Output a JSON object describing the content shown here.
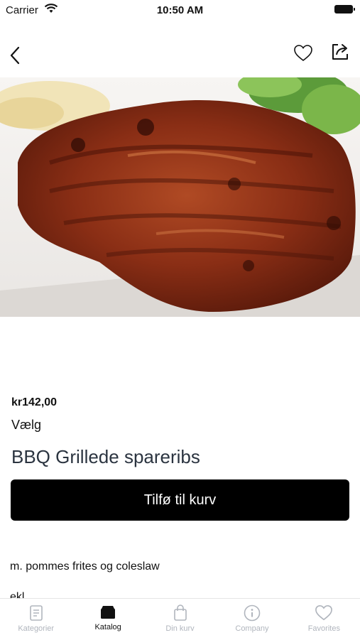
{
  "status_bar": {
    "carrier": "Carrier",
    "time": "10:50 AM"
  },
  "nav": {
    "back_icon": "chevron-left-icon",
    "favorite_icon": "heart-outline-icon",
    "share_icon": "share-icon"
  },
  "product": {
    "price": "kr142,00",
    "variant_label": "Vælg",
    "title": "BBQ Grillede spareribs",
    "add_to_cart_label": "Tilfø til kurv",
    "description": "m. pommes frites og coleslaw",
    "description_partial": "ekl. . . . . . ."
  },
  "tab_bar": {
    "tabs": [
      {
        "label": "Kategorier",
        "icon": "book-icon",
        "active": false
      },
      {
        "label": "Katalog",
        "icon": "catalog-icon",
        "active": true
      },
      {
        "label": "Din kurv",
        "icon": "shopping-bag-icon",
        "active": false
      },
      {
        "label": "Company",
        "icon": "info-circle-icon",
        "active": false
      },
      {
        "label": "Favorites",
        "icon": "heart-icon",
        "active": false
      }
    ]
  },
  "colors": {
    "accent": "#000000",
    "inactive_tab": "#b0b5bd",
    "title": "#2b3440"
  }
}
